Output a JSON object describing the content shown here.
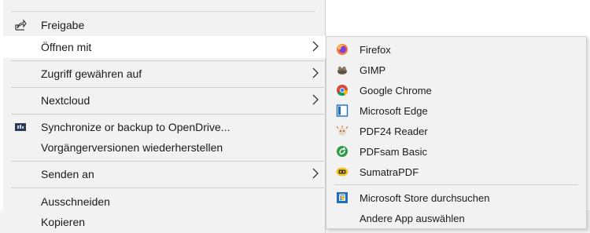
{
  "menu": {
    "items": [
      {
        "label": "Freigabe",
        "icon": "share-icon"
      },
      {
        "label": "Öffnen mit",
        "icon": ""
      },
      {
        "label": "Zugriff gewähren auf",
        "icon": ""
      },
      {
        "label": "Nextcloud",
        "icon": ""
      },
      {
        "label": "Synchronize or backup to OpenDrive...",
        "icon": "opendrive-icon"
      },
      {
        "label": "Vorgängerversionen wiederherstellen",
        "icon": ""
      },
      {
        "label": "Senden an",
        "icon": ""
      },
      {
        "label": "Ausschneiden",
        "icon": ""
      },
      {
        "label": "Kopieren",
        "icon": ""
      }
    ]
  },
  "submenu": {
    "items": [
      {
        "label": "Firefox",
        "icon": "firefox-icon"
      },
      {
        "label": "GIMP",
        "icon": "gimp-icon"
      },
      {
        "label": "Google Chrome",
        "icon": "chrome-icon"
      },
      {
        "label": "Microsoft Edge",
        "icon": "edge-icon"
      },
      {
        "label": "PDF24 Reader",
        "icon": "pdf24-icon"
      },
      {
        "label": "PDFsam Basic",
        "icon": "pdfsam-icon"
      },
      {
        "label": "SumatraPDF",
        "icon": "sumatrapdf-icon"
      },
      {
        "label": "Microsoft Store durchsuchen",
        "icon": "microsoft-store-icon"
      },
      {
        "label": "Andere App auswählen",
        "icon": ""
      }
    ]
  },
  "colors": {
    "menu_bg": "#f2f2f2",
    "hover_bg": "#ffffff",
    "separator": "#d0d0d0"
  }
}
